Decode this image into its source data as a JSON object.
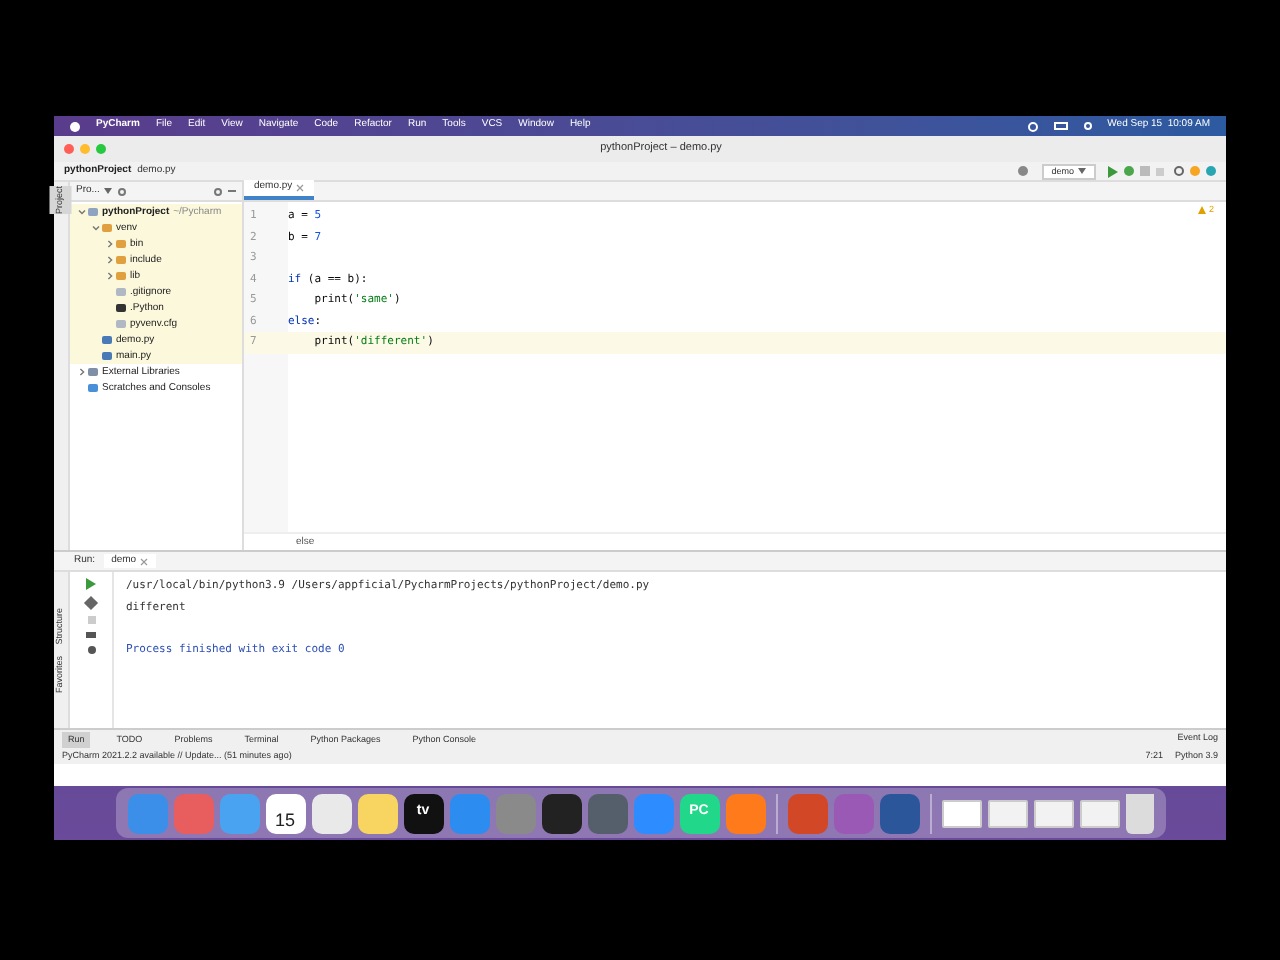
{
  "menu_bar": {
    "app": "PyCharm",
    "items": [
      "File",
      "Edit",
      "View",
      "Navigate",
      "Code",
      "Refactor",
      "Run",
      "Tools",
      "VCS",
      "Window",
      "Help"
    ],
    "clock": "Wed Sep 15  10:09 AM"
  },
  "window": {
    "title": "pythonProject – demo.py"
  },
  "breadcrumb": [
    "pythonProject",
    "demo.py"
  ],
  "run_config": "demo",
  "side_tabs_left": [
    "Project"
  ],
  "project_panel": {
    "selector": "Pro...",
    "tree": [
      {
        "label": "pythonProject",
        "suffix": "~/Pycharm",
        "kind": "project",
        "expanded": true,
        "children": [
          {
            "label": "venv",
            "kind": "folder",
            "expanded": true,
            "children": [
              {
                "label": "bin",
                "kind": "folder",
                "expanded": false
              },
              {
                "label": "include",
                "kind": "folder",
                "expanded": false
              },
              {
                "label": "lib",
                "kind": "folder",
                "expanded": false
              },
              {
                "label": ".gitignore",
                "kind": "file"
              },
              {
                "label": ".Python",
                "kind": "binary"
              },
              {
                "label": "pyvenv.cfg",
                "kind": "file"
              }
            ]
          },
          {
            "label": "demo.py",
            "kind": "python"
          },
          {
            "label": "main.py",
            "kind": "python"
          }
        ]
      },
      {
        "label": "External Libraries",
        "kind": "library",
        "expanded": false
      },
      {
        "label": "Scratches and Consoles",
        "kind": "scratch"
      }
    ]
  },
  "editor": {
    "tab": "demo.py",
    "inspection_count": "2",
    "footer": "else",
    "lines": [
      {
        "number": "1",
        "current": false,
        "tokens": [
          {
            "kind": "plain",
            "text": "a = "
          },
          {
            "kind": "number",
            "text": "5"
          }
        ]
      },
      {
        "number": "2",
        "current": false,
        "tokens": [
          {
            "kind": "plain",
            "text": "b = "
          },
          {
            "kind": "number",
            "text": "7"
          }
        ]
      },
      {
        "number": "3",
        "current": false
      },
      {
        "number": "4",
        "current": false,
        "tokens": [
          {
            "kind": "keyword",
            "text": "if"
          },
          {
            "kind": "plain",
            "text": " (a == b):"
          }
        ]
      },
      {
        "number": "5",
        "current": false,
        "tokens": [
          {
            "kind": "plain",
            "text": "    print("
          },
          {
            "kind": "string",
            "text": "'same'"
          },
          {
            "kind": "plain",
            "text": ")"
          }
        ]
      },
      {
        "number": "6",
        "current": false,
        "tokens": [
          {
            "kind": "keyword",
            "text": "else"
          },
          {
            "kind": "plain",
            "text": ":"
          }
        ]
      },
      {
        "number": "7",
        "current": true,
        "tokens": [
          {
            "kind": "plain",
            "text": "    print("
          },
          {
            "kind": "string",
            "text": "'different'"
          },
          {
            "kind": "plain",
            "text": ")"
          }
        ]
      }
    ]
  },
  "run_panel": {
    "label": "Run:",
    "tab": "demo",
    "output": [
      {
        "kind": "command",
        "text": "/usr/local/bin/python3.9 /Users/appficial/PycharmProjects/pythonProject/demo.py"
      },
      {
        "kind": "output",
        "text": "different"
      },
      {
        "kind": "info",
        "text": "Process finished with exit code 0"
      }
    ],
    "side_tabs": [
      "Structure",
      "Favorites"
    ]
  },
  "tool_tabs": [
    {
      "label": "Run",
      "selected": true
    },
    {
      "label": "TODO",
      "selected": false
    },
    {
      "label": "Problems",
      "selected": false
    },
    {
      "label": "Terminal",
      "selected": false
    },
    {
      "label": "Python Packages",
      "selected": false
    },
    {
      "label": "Python Console",
      "selected": false
    }
  ],
  "event_log": "Event Log",
  "status_bar": {
    "message": "PyCharm 2021.2.2 available // Update... (51 minutes ago)",
    "position": "7:21",
    "interpreter": "Python 3.9"
  },
  "dock": [
    {
      "kind": "app",
      "color": "#3b8fe8"
    },
    {
      "kind": "app",
      "color": "#e85d5d"
    },
    {
      "kind": "app",
      "color": "#4aa3f0"
    },
    {
      "kind": "calendar",
      "text": "15",
      "color": "#ffffff"
    },
    {
      "kind": "app",
      "color": "#e9e9e9"
    },
    {
      "kind": "app",
      "color": "#f7d560"
    },
    {
      "kind": "app",
      "text": "tv",
      "color": "#111111"
    },
    {
      "kind": "app",
      "color": "#2d8cf0"
    },
    {
      "kind": "app",
      "color": "#8a8a8a"
    },
    {
      "kind": "app",
      "color": "#222222"
    },
    {
      "kind": "app",
      "color": "#555f6b"
    },
    {
      "kind": "app",
      "color": "#2d8cff"
    },
    {
      "kind": "app",
      "text": "PC",
      "color": "#21d789"
    },
    {
      "kind": "app",
      "color": "#ff7a1a"
    },
    {
      "kind": "separator"
    },
    {
      "kind": "app",
      "color": "#d24726"
    },
    {
      "kind": "app",
      "color": "#9b59b6"
    },
    {
      "kind": "app",
      "color": "#2b579a"
    },
    {
      "kind": "separator"
    },
    {
      "kind": "doc",
      "color": "#ffffff"
    },
    {
      "kind": "doc",
      "color": "#f2f2f2"
    },
    {
      "kind": "doc",
      "color": "#f2f2f2"
    },
    {
      "kind": "doc",
      "color": "#f2f2f2"
    },
    {
      "kind": "trash",
      "color": "#dcdcdc"
    }
  ]
}
